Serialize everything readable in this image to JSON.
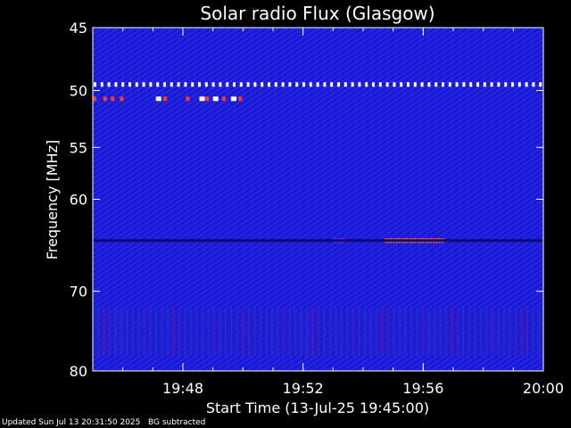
{
  "chart_data": {
    "type": "heatmap",
    "title": "Solar radio Flux (Glasgow)",
    "xlabel": "Start Time (13-Jul-25 19:45:00)",
    "ylabel": "Frequency [MHz]",
    "x_range_minutes": [
      0,
      15
    ],
    "x_ticks": [
      {
        "minute": 3,
        "label": "19:48"
      },
      {
        "minute": 7,
        "label": "19:52"
      },
      {
        "minute": 11,
        "label": "19:56"
      },
      {
        "minute": 15,
        "label": "20:00"
      }
    ],
    "y_scale": "log",
    "y_range_mhz": [
      45,
      80
    ],
    "y_ticks": [
      45,
      50,
      55,
      60,
      70,
      80
    ],
    "grid": false,
    "features": [
      {
        "name": "interference line",
        "freq_mhz": 49.5,
        "start_min": 0,
        "end_min": 15,
        "intensity": "saturated",
        "pattern": "dotted"
      },
      {
        "name": "interference blips",
        "freq_mhz": 50.7,
        "start_min": 0,
        "end_min": 5,
        "intensity": "high",
        "pattern": "intermittent"
      },
      {
        "name": "emission band",
        "freq_mhz": 64.3,
        "start_min": 9.7,
        "end_min": 11.7,
        "intensity": "high",
        "pattern": "continuous"
      },
      {
        "name": "emission band",
        "freq_mhz": 64.3,
        "start_min": 8.0,
        "end_min": 8.4,
        "intensity": "medium",
        "pattern": "continuous"
      },
      {
        "name": "dark band",
        "freq_mhz": 64.3,
        "start_min": 0,
        "end_min": 15,
        "intensity": "low",
        "pattern": "continuous"
      },
      {
        "name": "lower-band noise",
        "freq_mhz_range": [
          72,
          78
        ],
        "start_min": 0,
        "end_min": 15,
        "intensity": "medium",
        "pattern": "striped"
      }
    ],
    "colors": {
      "background": "#000000",
      "base": "#1a1ad8",
      "dark": "#0a0a70",
      "high": "#ff3a1e",
      "saturated": "#ffffff",
      "text": "#ffffff"
    }
  },
  "footer": {
    "updated": "Updated Sun Jul 13 20:31:50 2025",
    "note": "BG subtracted"
  }
}
